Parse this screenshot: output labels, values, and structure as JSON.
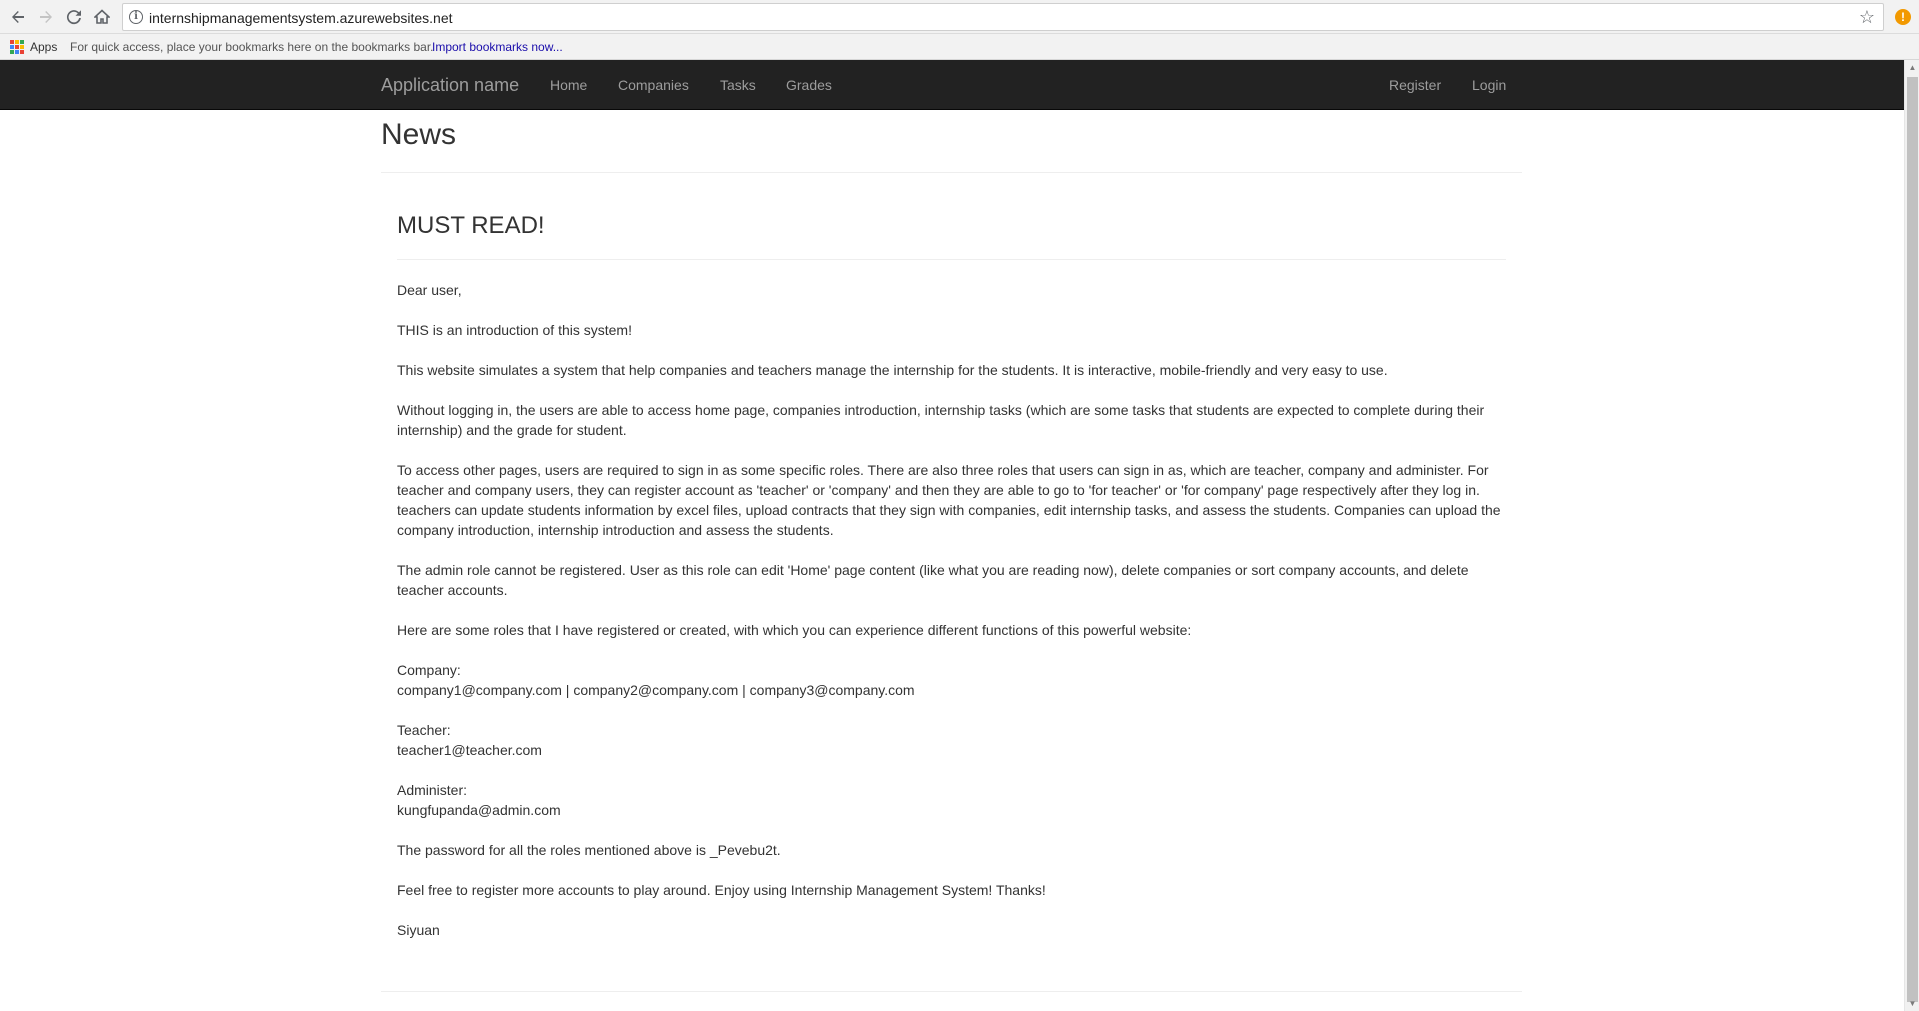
{
  "browser": {
    "url": "internshipmanagementsystem.azurewebsites.net",
    "bookmarks_bar": {
      "apps_label": "Apps",
      "hint": "For quick access, place your bookmarks here on the bookmarks bar.",
      "import_link": "Import bookmarks now..."
    }
  },
  "navbar": {
    "brand": "Application name",
    "links": [
      "Home",
      "Companies",
      "Tasks",
      "Grades"
    ],
    "right_links": [
      "Register",
      "Login"
    ]
  },
  "page": {
    "title": "News",
    "article": {
      "title": "MUST READ!",
      "paragraphs": [
        "Dear user,",
        "THIS is an introduction of this system!",
        "This website simulates a system that help companies and teachers manage the internship for the students. It is interactive, mobile-friendly and very easy to use.",
        "Without logging in, the users are able to access home page, companies introduction, internship tasks (which are some tasks that students are expected to complete during their internship) and the grade for student.",
        "To access other pages, users are required to sign in as some specific roles. There are also three roles that users can sign in as, which are teacher, company and administer. For teacher and company users, they can register account as 'teacher' or 'company' and then they are able to go to 'for teacher' or 'for company' page respectively after they log in. teachers can update students information by excel files, upload contracts that they sign with companies, edit internship tasks, and assess the students. Companies can upload the company introduction, internship introduction and assess the students.",
        "The admin role cannot be registered. User as this role can edit 'Home' page content (like what you are reading now), delete companies or sort company accounts, and delete teacher accounts.",
        "Here are some roles that I have registered or created, with which you can experience different functions of this powerful website:"
      ],
      "roles": {
        "company_label": "Company:",
        "company_accounts": "company1@company.com | company2@company.com | company3@company.com",
        "teacher_label": "Teacher:",
        "teacher_accounts": "teacher1@teacher.com",
        "admin_label": "Administer:",
        "admin_accounts": "kungfupanda@admin.com"
      },
      "closing": [
        "The password for all the roles mentioned above is _Pevebu2t.",
        "Feel free to register more accounts to play around. Enjoy using Internship Management System! Thanks!",
        "Siyuan"
      ]
    }
  }
}
